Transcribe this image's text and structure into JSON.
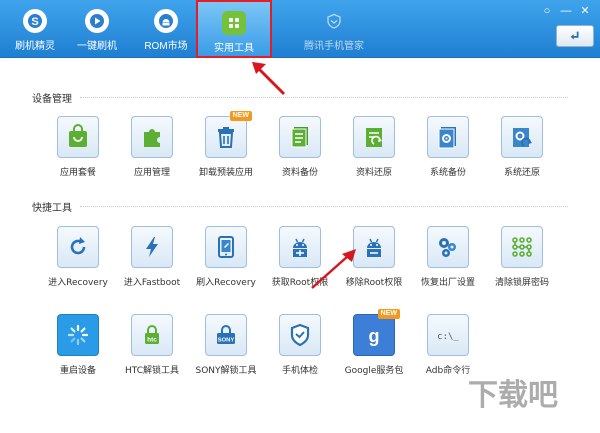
{
  "toolbar": {
    "tabs": [
      {
        "label": "刷机精灵",
        "icon": "logo-s-icon"
      },
      {
        "label": "一键刷机",
        "icon": "play-icon"
      },
      {
        "label": "ROM市场",
        "icon": "android-icon"
      },
      {
        "label": "实用工具",
        "icon": "grid-icon",
        "active": true
      },
      {
        "label": "腾讯手机管家",
        "icon": "shield-icon",
        "disabled": true
      }
    ],
    "window_controls": [
      "○",
      "—",
      "✕"
    ],
    "back_icon": "return-arrow-icon"
  },
  "sections": [
    {
      "title": "设备管理",
      "items": [
        {
          "label": "应用套餐",
          "icon": "shopping-bag-icon",
          "color": "#5bb033"
        },
        {
          "label": "应用管理",
          "icon": "puzzle-icon",
          "color": "#5bb033"
        },
        {
          "label": "卸载预装应用",
          "icon": "trash-icon",
          "color": "#2a72b8",
          "badge": "NEW"
        },
        {
          "label": "资料备份",
          "icon": "document-icon",
          "color": "#5bb033"
        },
        {
          "label": "资料还原",
          "icon": "document-restore-icon",
          "color": "#5bb033"
        },
        {
          "label": "系统备份",
          "icon": "system-backup-icon",
          "color": "#2a72b8"
        },
        {
          "label": "系统还原",
          "icon": "system-restore-icon",
          "color": "#2a72b8"
        }
      ]
    },
    {
      "title": "快捷工具",
      "items": [
        {
          "label": "进入Recovery",
          "icon": "refresh-icon",
          "color": "#2a72b8"
        },
        {
          "label": "进入Fastboot",
          "icon": "lightning-icon",
          "color": "#2a72b8"
        },
        {
          "label": "刷入Recovery",
          "icon": "tablet-icon",
          "color": "#2a72b8"
        },
        {
          "label": "获取Root权限",
          "icon": "android-root-icon",
          "color": "#2a72b8"
        },
        {
          "label": "移除Root权限",
          "icon": "android-remove-root-icon",
          "color": "#2a72b8"
        },
        {
          "label": "恢复出厂设置",
          "icon": "gears-icon",
          "color": "#2a72b8"
        },
        {
          "label": "清除锁屏密码",
          "icon": "pattern-lock-icon",
          "color": "#5bb033"
        },
        {
          "label": "重启设备",
          "icon": "spinner-icon",
          "color": "#2a9be6"
        },
        {
          "label": "HTC解锁工具",
          "icon": "htc-lock-icon",
          "color": "#5bb033",
          "sub": "htc"
        },
        {
          "label": "SONY解锁工具",
          "icon": "sony-lock-icon",
          "color": "#2a72b8",
          "sub": "SONY"
        },
        {
          "label": "手机体检",
          "icon": "shield-check-icon",
          "color": "#2a72b8"
        },
        {
          "label": "Google服务包",
          "icon": "google-icon",
          "color": "#2a72b8",
          "badge": "NEW"
        },
        {
          "label": "Adb命令行",
          "icon": "terminal-icon",
          "color": "#555555",
          "sub": "c:\\_"
        }
      ]
    }
  ],
  "watermark": "下载吧"
}
